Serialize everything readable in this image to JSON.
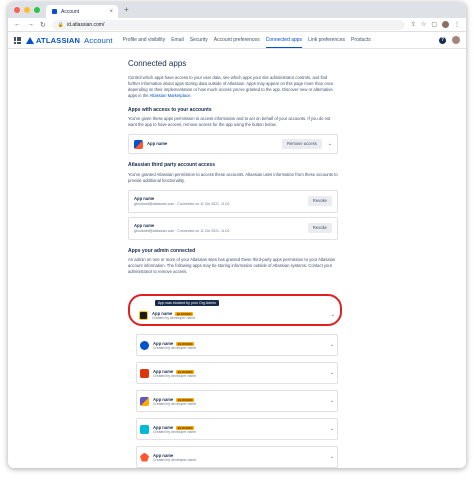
{
  "browser": {
    "tab_title": "Account",
    "tab_close": "×",
    "new_tab": "+",
    "url": "id.atlassian.com/"
  },
  "header": {
    "logo_text": "ATLASSIAN",
    "logo_sub": "Account",
    "nav": [
      "Profile and visibility",
      "Email",
      "Security",
      "Account preferences",
      "Connected apps",
      "Link preferences",
      "Products"
    ],
    "active_nav": "Connected apps",
    "help": "?"
  },
  "page": {
    "title": "Connected apps",
    "intro": "Control which apps have access to your user data, see which apps your site administrator controls, and find further information about apps storing data outside of Atlassian. Apps may appear on this page more than once depending on their implementation or how much access you've granted to the app. Discover new or alternative apps in the",
    "intro_link": "Atlassian Marketplace.",
    "section1": {
      "title": "Apps with access to your accounts",
      "desc": "You've given these apps permission to access information and to act on behalf of your accounts. If you do not want the app to have access, remove access for the app using the button below.",
      "app_name": "App name",
      "button": "Remove access",
      "chevron": "⌄"
    },
    "section2": {
      "title": "Atlassian third party account access",
      "desc": "You've granted Atlassian permission to access these accounts. Atlassian uses information from these accounts to provide additional functionality.",
      "items": [
        {
          "name": "App name",
          "sub": "gbuckwell@atlassian.com  ·  Connected on 11 Oct 2021, 11:02",
          "button": "Revoke"
        },
        {
          "name": "App name",
          "sub": "gbuckwell@atlassian.com  ·  Connected on 11 Oct 2021, 11:02",
          "button": "Revoke"
        }
      ]
    },
    "section3": {
      "title": "Apps your admin connected",
      "desc": "An admin on one or more of your Atlassian sites has granted these third-party apps permission to your Atlassian account information. The following apps may be storing information outside of Atlassian systems. Contact your administrator to remove access.",
      "tooltip": "App was blocked by your Org Admin",
      "items": [
        {
          "name": "App name",
          "badge": "BLOCKED",
          "sub": "Created by developer name",
          "color": "#1a1a1a",
          "chevron": "⌄"
        },
        {
          "name": "App name",
          "badge": "BLOCKED",
          "sub": "Created by developer name",
          "color": "#0052cc",
          "chevron": "⌄"
        },
        {
          "name": "App name",
          "badge": "BLOCKED",
          "sub": "Created by developer name",
          "color": "#de350b",
          "chevron": "⌄"
        },
        {
          "name": "App name",
          "badge": "BLOCKED",
          "sub": "Created by developer name",
          "color": "#6554c0",
          "chevron": "⌄"
        },
        {
          "name": "App name",
          "badge": "BLOCKED",
          "sub": "Created by developer name",
          "color": "#00b8d9",
          "chevron": "⌄"
        },
        {
          "name": "App name",
          "badge": "",
          "sub": "Created by developer name",
          "color": "#ff5630",
          "chevron": "⌄"
        }
      ]
    }
  }
}
